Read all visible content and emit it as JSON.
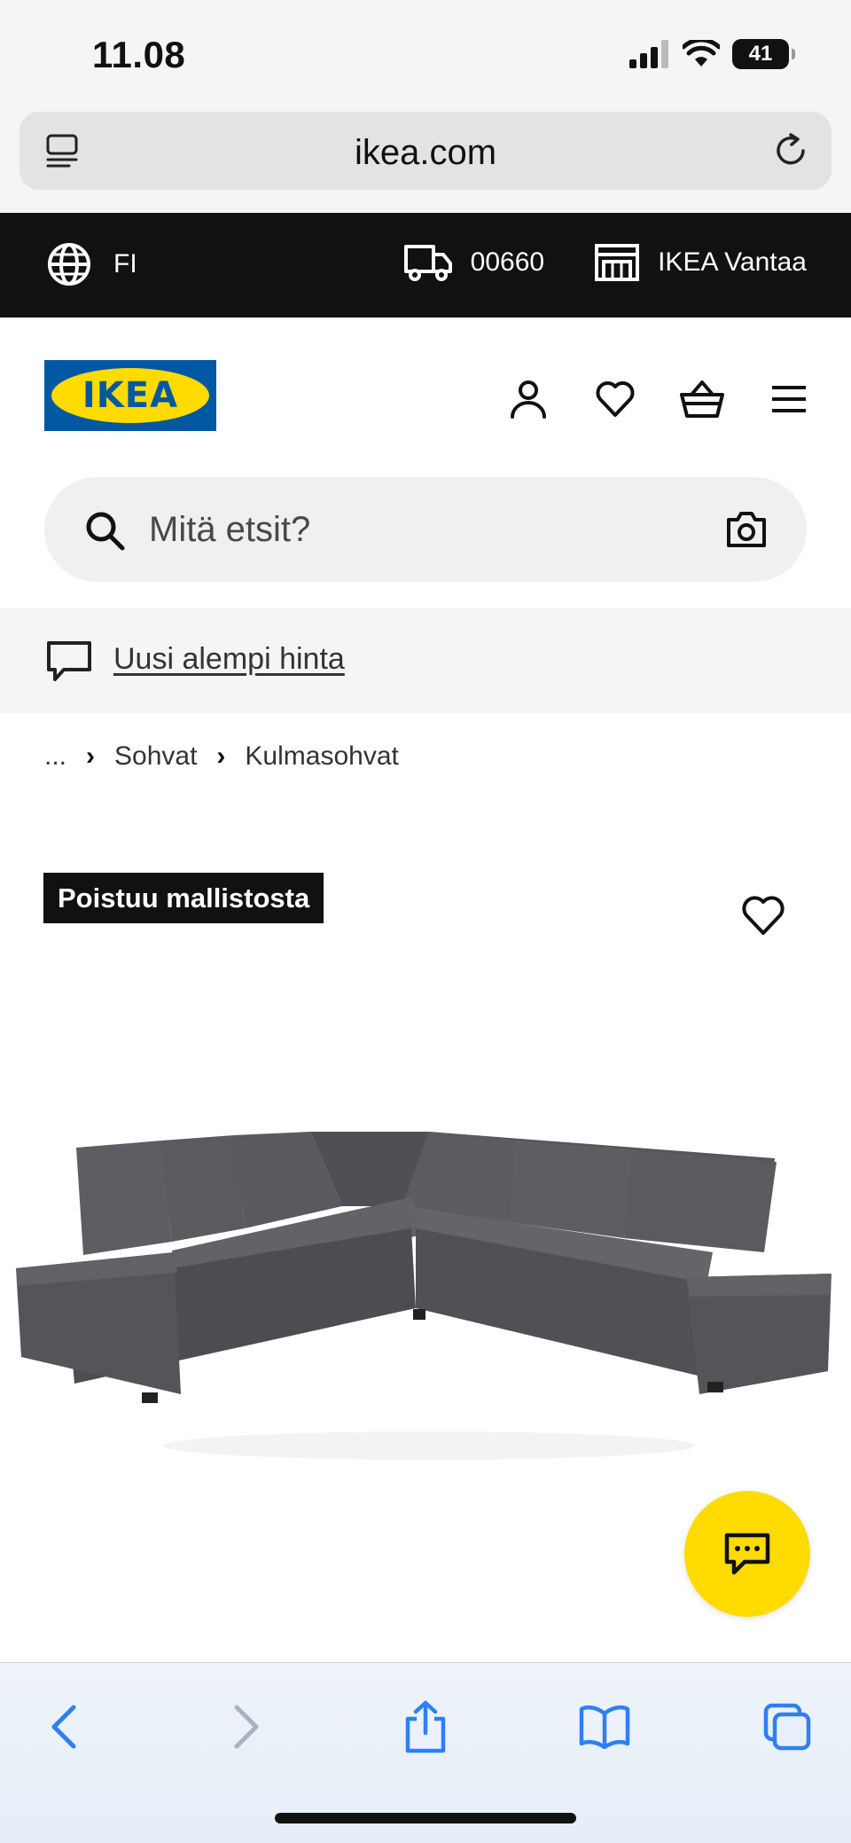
{
  "status_bar": {
    "time": "11.08",
    "battery": "41"
  },
  "browser": {
    "url": "ikea.com"
  },
  "top_strip": {
    "language": "FI",
    "postal_code": "00660",
    "store": "IKEA Vantaa"
  },
  "header": {
    "logo_text": "IKEA",
    "search_placeholder": "Mitä etsit?"
  },
  "promo": {
    "text": "Uusi alempi hinta"
  },
  "breadcrumb": {
    "ellipsis": "...",
    "items": [
      "Sohvat",
      "Kulmasohvat"
    ]
  },
  "product": {
    "badge": "Poistuu mallistosta"
  },
  "colors": {
    "ikea_blue": "#0058a3",
    "ikea_yellow": "#ffdb00",
    "strip_black": "#111111",
    "safari_blue": "#2f7ff2"
  }
}
